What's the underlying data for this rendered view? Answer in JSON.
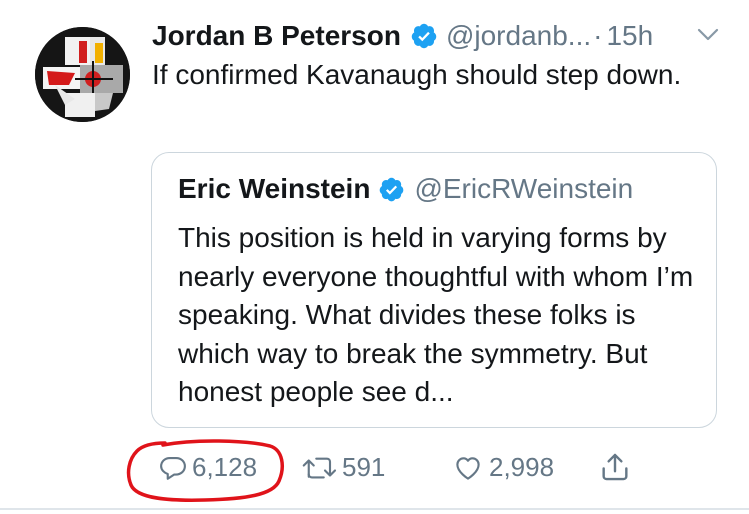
{
  "tweet": {
    "author_name": "Jordan B Peterson",
    "author_handle": "@jordanb...",
    "separator": "·",
    "timestamp": "15h",
    "text": "If confirmed Kavanaugh should step down."
  },
  "quoted_tweet": {
    "author_name": "Eric Weinstein",
    "author_handle": "@EricRWeinstein",
    "text": "This position is held in varying forms by nearly everyone thoughtful with whom I’m speaking. What divides these folks is which way to break the symmetry. But honest people see d..."
  },
  "actions": {
    "reply_count": "6,128",
    "retweet_count": "591",
    "like_count": "2,998"
  },
  "icons": {
    "verified": "verified-badge-icon",
    "caret": "chevron-down-icon",
    "reply": "reply-bubble-icon",
    "retweet": "retweet-icon",
    "like": "heart-icon",
    "share": "share-upload-icon"
  },
  "colors": {
    "verified_blue": "#1da1f2",
    "secondary_text": "#657786",
    "annotation_red": "#e0131a",
    "quote_border": "#ccd6dd"
  }
}
